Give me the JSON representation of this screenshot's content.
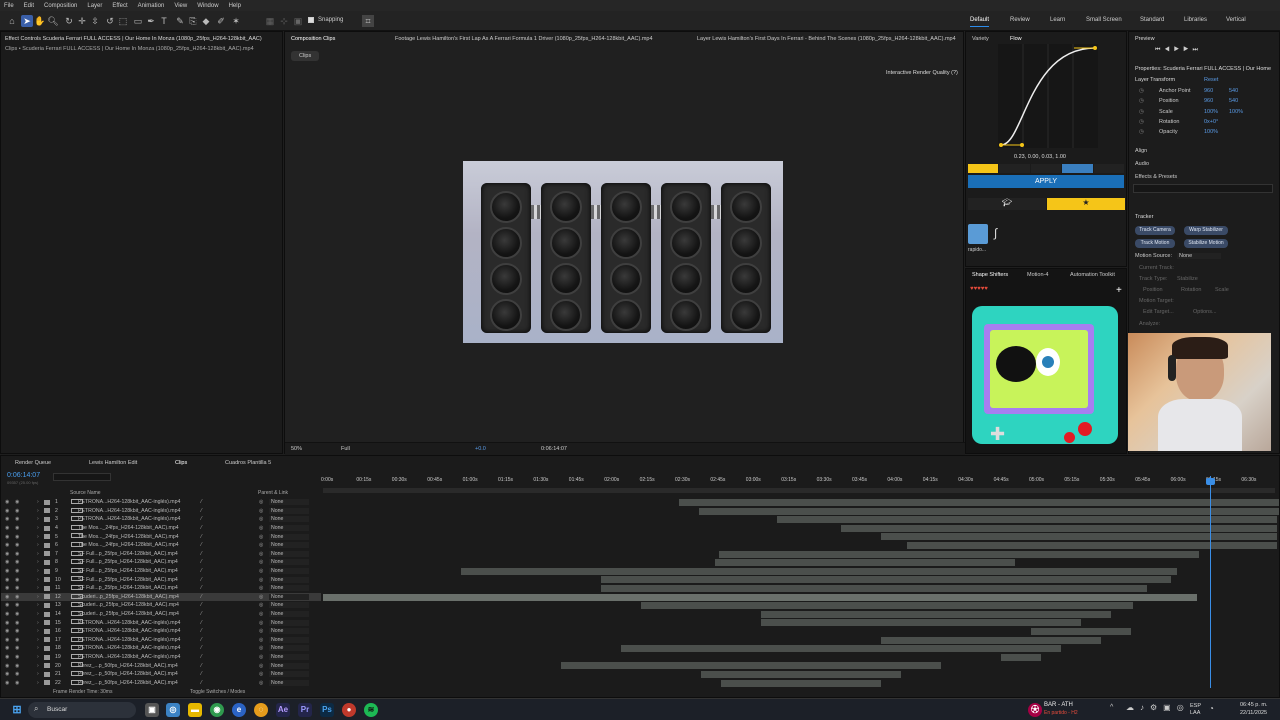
{
  "menu": [
    "File",
    "Edit",
    "Composition",
    "Layer",
    "Effect",
    "Animation",
    "View",
    "Window",
    "Help"
  ],
  "toolbar": {
    "snapping_label": "Snapping"
  },
  "workspaces": [
    "Default",
    "Review",
    "Learn",
    "Small Screen",
    "Standard",
    "Libraries",
    "Vertical"
  ],
  "left_panel": {
    "tab": "Effect Controls Scuderia Ferrari FULL ACCESS | Our Home In Monza (1080p_25fps_H264-128kbit_AAC)",
    "subtitle": "Clips • Scuderia Ferrari FULL ACCESS | Our Home In Monza (1080p_25fps_H264-128kbit_AAC).mp4"
  },
  "comp_tabs": {
    "comp": "Composition Clips",
    "footage": "Footage Lewis Hamilton's First Lap As A Ferrari Formula 1 Driver (1080p_25fps_H264-128kbit_AAC).mp4",
    "layer": "Layer Lewis Hamilton's First Days In Ferrari - Behind The Scenes (1080p_25fps_H264-128kbit_AAC).mp4",
    "clips_chip": "Clips",
    "render_quality": "Interactive Render Quality (?)"
  },
  "viewer_footer": {
    "zoom": "50%",
    "res": "Full",
    "exposure": "+0.0",
    "timecode": "0:06:14:07"
  },
  "flow": {
    "tab_variety": "Variety",
    "tab_flow": "Flow",
    "values": "0.23, 0.00, 0.03, 1.00",
    "apply": "APPLY",
    "preset_label": "rapido...",
    "accent": "#f5c518"
  },
  "shape_tabs": [
    "Shape Shifters",
    "Motion-4",
    "Automation Toolkit"
  ],
  "preview": {
    "title": "Preview"
  },
  "properties": {
    "title": "Properties: Scuderia Ferrari FULL ACCESS | Our Home",
    "section": "Layer Transform",
    "reset": "Reset",
    "rows": [
      {
        "name": "Anchor Point",
        "v1": "960",
        "v2": "540"
      },
      {
        "name": "Position",
        "v1": "960",
        "v2": "540"
      },
      {
        "name": "Scale",
        "v1": "100%",
        "v2": "100%"
      },
      {
        "name": "Rotation",
        "v1": "0x+0°",
        "v2": ""
      },
      {
        "name": "Opacity",
        "v1": "100%",
        "v2": ""
      }
    ],
    "align": "Align",
    "audio": "Audio",
    "effects": "Effects & Presets"
  },
  "tracker": {
    "title": "Tracker",
    "buttons": [
      "Track Camera",
      "Warp Stabilizer",
      "Track Motion",
      "Stabilize Motion"
    ],
    "motion_source_label": "Motion Source:",
    "motion_source": "None",
    "current_track": "Current Track:",
    "track_type": "Track Type:",
    "track_type_val": "Stabilize",
    "position": "Position",
    "rotation": "Rotation",
    "scale": "Scale",
    "motion_target": "Motion Target:",
    "edit_target": "Edit Target...",
    "options": "Options...",
    "analyze": "Analyze:"
  },
  "timeline": {
    "tabs": [
      "Render Queue",
      "Lewis Hamilton Edit",
      "Clips",
      "Cuadros Plantilla 5"
    ],
    "timecode": "0:06:14:07",
    "subtc": "09357 (25.00 fps)",
    "col_source": "Source Name",
    "col_parent": "Parent & Link",
    "ruler": [
      "0:00s",
      "00:15s",
      "00:30s",
      "00:45s",
      "01:00s",
      "01:15s",
      "01:30s",
      "01:45s",
      "02:00s",
      "02:15s",
      "02:30s",
      "02:45s",
      "03:00s",
      "03:15s",
      "03:30s",
      "03:45s",
      "04:00s",
      "04:15s",
      "04:30s",
      "04:45s",
      "05:00s",
      "05:15s",
      "05:30s",
      "05:45s",
      "06:00s",
      "06:15s",
      "06:30s"
    ],
    "layers": [
      {
        "n": "1",
        "name": "PETRONA...H264-128kbit_AAC-inglés).mp4"
      },
      {
        "n": "2",
        "name": "PETRONA...H264-128kbit_AAC-inglés).mp4"
      },
      {
        "n": "3",
        "name": "PETRONA...H264-128kbit_AAC-inglés).mp4"
      },
      {
        "n": "4",
        "name": "The Mos..._24fps_H264-128kbit_AAC).mp4"
      },
      {
        "n": "5",
        "name": "The Mos..._24fps_H264-128kbit_AAC).mp4"
      },
      {
        "n": "6",
        "name": "The Mos..._24fps_H264-128kbit_AAC).mp4"
      },
      {
        "n": "7",
        "name": "SF Full...p_25fps_H264-128kbit_AAC).mp4"
      },
      {
        "n": "8",
        "name": "SF Full...p_25fps_H264-128kbit_AAC).mp4"
      },
      {
        "n": "9",
        "name": "SF Full...p_25fps_H264-128kbit_AAC).mp4"
      },
      {
        "n": "10",
        "name": "SF Full...p_25fps_H264-128kbit_AAC).mp4"
      },
      {
        "n": "11",
        "name": "SF Full...p_25fps_H264-128kbit_AAC).mp4"
      },
      {
        "n": "12",
        "name": "Scuderi...p_25fps_H264-128kbit_AAC).mp4"
      },
      {
        "n": "13",
        "name": "Scuderi...p_25fps_H264-128kbit_AAC).mp4"
      },
      {
        "n": "14",
        "name": "Scuderi...p_25fps_H264-128kbit_AAC).mp4"
      },
      {
        "n": "15",
        "name": "PETRONA...H264-128kbit_AAC-inglés).mp4"
      },
      {
        "n": "16",
        "name": "PETRONA...H264-128kbit_AAC-inglés).mp4"
      },
      {
        "n": "17",
        "name": "PETRONA...H264-128kbit_AAC-inglés).mp4"
      },
      {
        "n": "18",
        "name": "PETRONA...H264-128kbit_AAC-inglés).mp4"
      },
      {
        "n": "19",
        "name": "PETRONA...H264-128kbit_AAC-inglés).mp4"
      },
      {
        "n": "20",
        "name": "Perez_...p_50fps_H264-128kbit_AAC).mp4"
      },
      {
        "n": "21",
        "name": "Perez_...p_50fps_H264-128kbit_AAC).mp4"
      },
      {
        "n": "22",
        "name": "Perez_...p_50fps_H264-128kbit_AAC).mp4"
      }
    ],
    "parent_none": "None",
    "frame_render": "Frame Render Time: 30ms",
    "toggle": "Toggle Switches / Modes"
  },
  "taskbar": {
    "search": "Buscar",
    "match": "BAR - ATH",
    "match_status": "En partido - H2",
    "lang": "ESP",
    "lang2": "LAA",
    "time": "06:45 p. m.",
    "date": "22/11/2025"
  }
}
